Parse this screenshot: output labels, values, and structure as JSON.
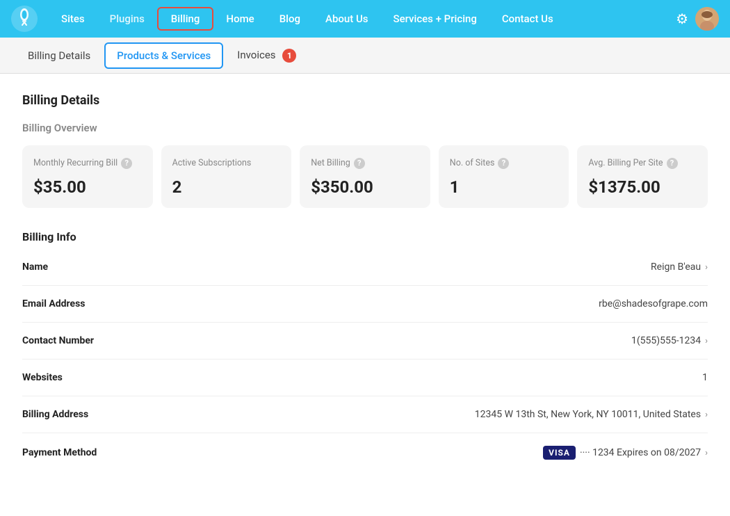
{
  "nav": {
    "links": [
      {
        "label": "Sites",
        "id": "sites",
        "active": false,
        "muted": false
      },
      {
        "label": "Plugins",
        "id": "plugins",
        "active": false,
        "muted": true
      },
      {
        "label": "Billing",
        "id": "billing",
        "active": true,
        "muted": false
      },
      {
        "label": "Home",
        "id": "home",
        "active": false,
        "muted": false
      },
      {
        "label": "Blog",
        "id": "blog",
        "active": false,
        "muted": false
      },
      {
        "label": "About Us",
        "id": "about",
        "active": false,
        "muted": false
      },
      {
        "label": "Services + Pricing",
        "id": "services",
        "active": false,
        "muted": false
      },
      {
        "label": "Contact Us",
        "id": "contact",
        "active": false,
        "muted": false
      }
    ]
  },
  "subnav": {
    "items": [
      {
        "label": "Billing Details",
        "id": "billing-details",
        "active": false
      },
      {
        "label": "Products & Services",
        "id": "products-services",
        "active": true
      },
      {
        "label": "Invoices",
        "id": "invoices",
        "active": false,
        "badge": "1"
      }
    ]
  },
  "main": {
    "page_title": "Billing Details",
    "overview_title": "Billing Overview",
    "cards": [
      {
        "label": "Monthly Recurring Bill",
        "help": true,
        "value": "$35.00"
      },
      {
        "label": "Active Subscriptions",
        "help": false,
        "value": "2"
      },
      {
        "label": "Net Billing",
        "help": true,
        "value": "$350.00"
      },
      {
        "label": "No. of Sites",
        "help": true,
        "value": "1"
      },
      {
        "label": "Avg. Billing Per Site",
        "help": true,
        "value": "$1375.00"
      }
    ],
    "billing_info_title": "Billing Info",
    "info_rows": [
      {
        "label": "Name",
        "value": "Reign B'eau",
        "chevron": true,
        "type": "text"
      },
      {
        "label": "Email Address",
        "value": "rbe@shadesofgrape.com",
        "chevron": false,
        "type": "text"
      },
      {
        "label": "Contact Number",
        "value": "1(555)555-1234",
        "chevron": true,
        "type": "text"
      },
      {
        "label": "Websites",
        "value": "1",
        "chevron": false,
        "type": "text"
      },
      {
        "label": "Billing Address",
        "value": "12345 W 13th St, New York, NY 10011, United States",
        "chevron": true,
        "type": "text"
      },
      {
        "label": "Payment Method",
        "value": "···· 1234  Expires on 08/2027",
        "chevron": true,
        "type": "payment"
      }
    ]
  },
  "icons": {
    "gear": "⚙",
    "help": "?",
    "chevron_right": "›"
  }
}
